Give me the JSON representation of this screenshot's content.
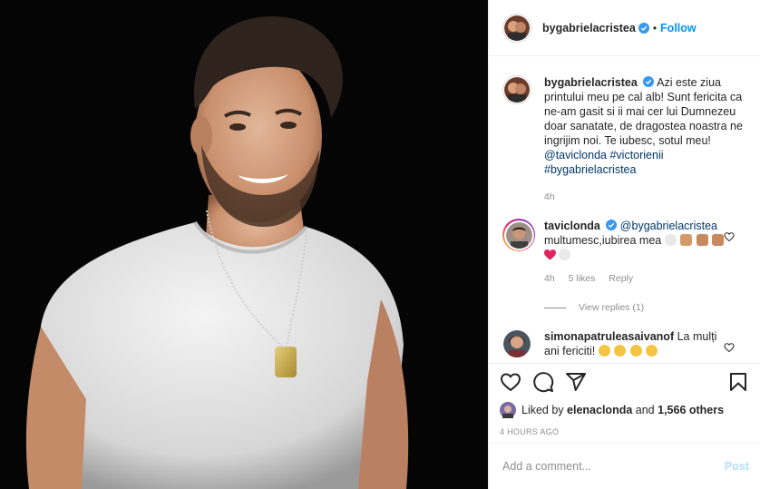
{
  "post": {
    "username": "bygabrielacristea",
    "follow_label": "Follow",
    "dot": "•"
  },
  "caption": {
    "username": "bygabrielacristea",
    "text": "Azi este ziua printului meu pe cal alb! Sunt fericita ca ne-am gasit si ii mai cer lui Dumnezeu doar sanatate, de dragostea noastra ne ingrijim noi. Te iubesc, sotul meu!",
    "mention": "@taviclonda",
    "hashtags": "#victorienii #bygabrielacristea",
    "time": "4h"
  },
  "comments": [
    {
      "username": "taviclonda",
      "mention": "@bygabrielacristea",
      "text": "multumesc,iubirea mea",
      "time": "4h",
      "likes": "5 likes",
      "reply_label": "Reply",
      "view_replies": "View replies (1)"
    },
    {
      "username": "simonapatruleasaivanof",
      "text": "La mulți ani fericiti!"
    }
  ],
  "likes": {
    "prefix": "Liked by",
    "user": "elenaclonda",
    "and": "and",
    "others": "1,566 others"
  },
  "timestamp": "4 HOURS AGO",
  "add_comment": {
    "placeholder": "Add a comment...",
    "post_label": "Post"
  },
  "icons": {
    "verified": "verified-badge-icon",
    "like": "heart-icon",
    "comment": "comment-icon",
    "share": "send-icon",
    "save": "bookmark-icon"
  },
  "colors": {
    "link": "#0095f6",
    "text": "#262626",
    "muted": "#8e8e8e",
    "mention": "#00376b"
  }
}
